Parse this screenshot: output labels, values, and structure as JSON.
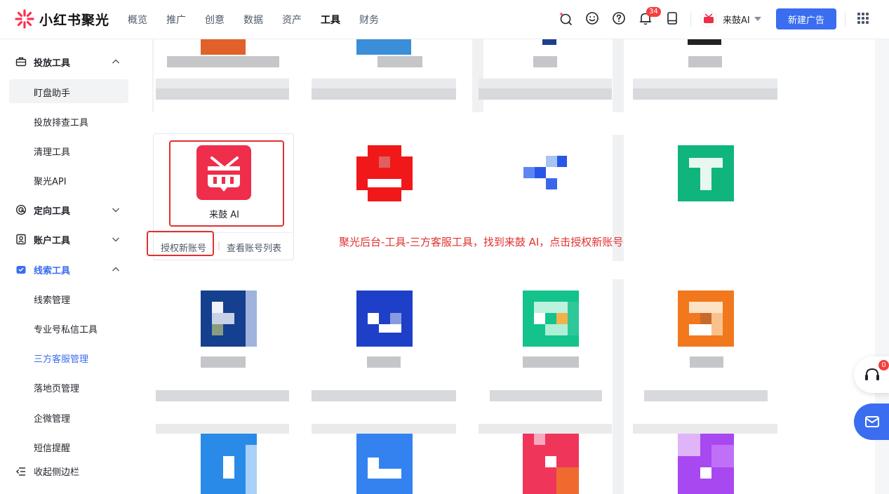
{
  "brand": {
    "name": "小红书聚光"
  },
  "nav": [
    "概览",
    "推广",
    "创意",
    "数据",
    "资产",
    "工具",
    "财务"
  ],
  "nav_active": "工具",
  "notifications": {
    "count": "34"
  },
  "account": {
    "name": "来鼓AI"
  },
  "new_ad_button": "新建广告",
  "sidebar": {
    "groups": [
      {
        "label": "投放工具",
        "icon": "briefcase-icon",
        "expanded": true,
        "items": [
          "盯盘助手",
          "投放排查工具",
          "清理工具",
          "聚光API"
        ]
      },
      {
        "label": "定向工具",
        "icon": "target-icon",
        "expanded": false,
        "items": []
      },
      {
        "label": "账户工具",
        "icon": "user-card-icon",
        "expanded": false,
        "items": []
      },
      {
        "label": "线索工具",
        "icon": "lead-icon",
        "expanded": true,
        "items": [
          "线索管理",
          "专业号私信工具",
          "三方客服管理",
          "落地页管理",
          "企微管理",
          "短信提醒"
        ]
      }
    ],
    "selected_item": "盯盘助手",
    "active_item": "三方客服管理",
    "collapse_label": "收起侧边栏"
  },
  "card": {
    "name": "来鼓 AI",
    "authorize_label": "授权新账号",
    "view_list_label": "查看账号列表"
  },
  "annotation": "聚光后台-工具-三方客服工具，找到来鼓 AI，点击授权新账号",
  "float_badge": "0",
  "colors": {
    "accent": "#3a6df0",
    "highlight": "#e0312f",
    "brand_red": "#ee2e4b"
  }
}
